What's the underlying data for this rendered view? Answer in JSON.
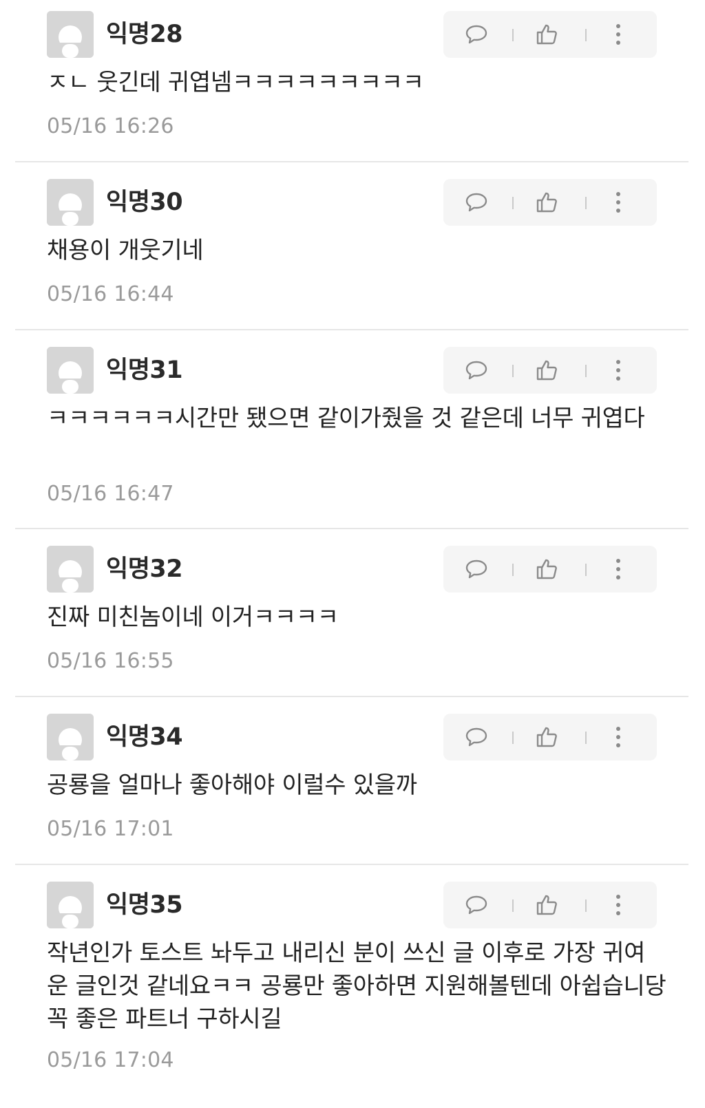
{
  "comments": [
    {
      "author": "익명28",
      "text": "ㅈㄴ 웃긴데 귀엽넴ㅋㅋㅋㅋㅋㅋㅋㅋㅋ",
      "timestamp": "05/16 16:26"
    },
    {
      "author": "익명30",
      "text": "채용이 개웃기네",
      "timestamp": "05/16 16:44"
    },
    {
      "author": "익명31",
      "text": "ㅋㅋㅋㅋㅋㅋ시간만 됐으면 같이가줬을 것 같은데 너무 귀엽다",
      "timestamp": "05/16 16:47"
    },
    {
      "author": "익명32",
      "text": "진짜 미친놈이네 이거ㅋㅋㅋㅋ",
      "timestamp": "05/16 16:55"
    },
    {
      "author": "익명34",
      "text": "공룡을 얼마나 좋아해야 이럴수 있을까",
      "timestamp": "05/16 17:01"
    },
    {
      "author": "익명35",
      "text": "작년인가 토스트 놔두고 내리신 분이 쓰신 글 이후로 가장 귀여운 글인것 같네요ㅋㅋ 공룡만 좋아하면 지원해볼텐데 아쉽습니당 꼭 좋은 파트너 구하시길",
      "timestamp": "05/16 17:04"
    }
  ],
  "icons": {
    "reply": "speech-bubble-icon",
    "like": "thumbs-up-icon",
    "more": "vertical-ellipsis-icon",
    "avatar": "anonymous-user-icon"
  },
  "colors": {
    "text": "#222222",
    "timestamp": "#9a9a9a",
    "action_bg": "#f5f5f5",
    "avatar_bg": "#d8d8d8",
    "divider": "#e6e6e6"
  }
}
